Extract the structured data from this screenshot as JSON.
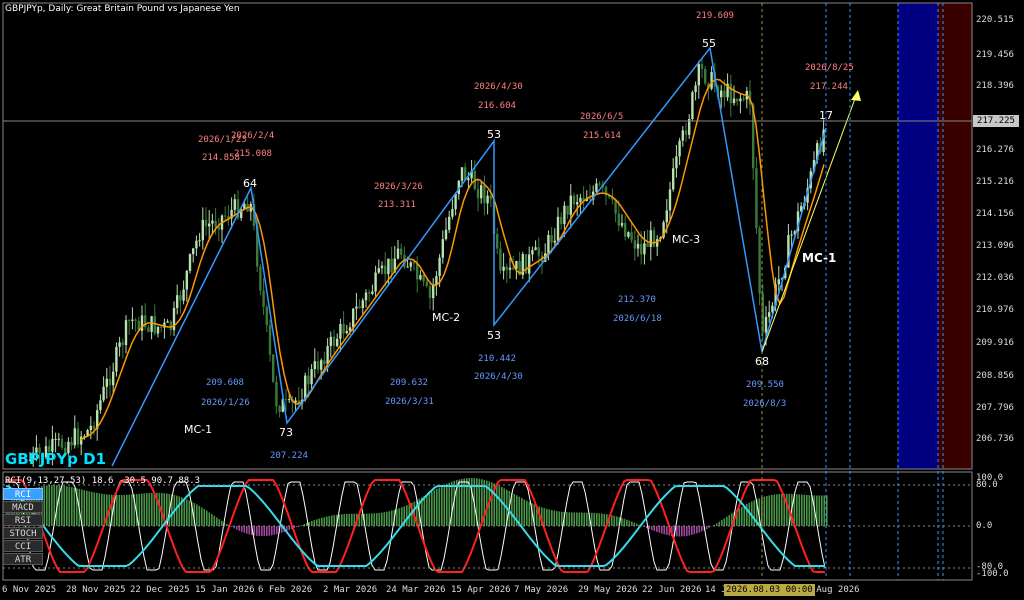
{
  "header": {
    "title": "GBPJPYp, Daily:  Great Britain Pound vs Japanese Yen",
    "big_label": "GBPJPYp D1"
  },
  "price_axis": {
    "ticks": [
      "220.515",
      "219.456",
      "218.396",
      "217.336",
      "216.276",
      "215.216",
      "214.156",
      "213.096",
      "212.036",
      "210.976",
      "209.916",
      "208.856",
      "207.796",
      "206.736"
    ],
    "current_price": "217.225"
  },
  "indicator": {
    "label": "RCI(9,13,27,53) 18.6 -30.5 90.7 88.3",
    "ticks": [
      "100.0",
      "80.0",
      "0.0",
      "-80.0",
      "-100.0"
    ],
    "buttons": [
      "RCI",
      "MACD",
      "RSI",
      "STOCH",
      "CCI",
      "ATR"
    ],
    "active_button": "RCI"
  },
  "time_axis": {
    "ticks": [
      "6 Nov 2025",
      "28 Nov 2025",
      "22 Dec 2025",
      "15 Jan 2026",
      "6 Feb 2026",
      "2 Mar 2026",
      "24 Mar 2026",
      "15 Apr 2026",
      "7 May 2026",
      "29 May 2026",
      "22 Jun 2026",
      "14 J",
      "26 Aug 2026"
    ],
    "crosshair_label": "2026.08.03 00:00"
  },
  "wave_labels": [
    "64",
    "73",
    "53",
    "53",
    "55",
    "68",
    "17"
  ],
  "cycle_labels": [
    "MC-1",
    "MC-2",
    "MC-3",
    "MC-1"
  ],
  "annotations": {
    "peaks": [
      {
        "date": "2026/1/23",
        "price": "214.858"
      },
      {
        "date": "2026/2/4",
        "price": "215.008"
      },
      {
        "date": "2026/3/26",
        "price": "213.311"
      },
      {
        "date": "2026/4/30",
        "price": "216.604"
      },
      {
        "date": "2026/6/5",
        "price": "215.614"
      },
      {
        "date": "",
        "price": "219.609"
      },
      {
        "date": "2026/8/25",
        "price": "217.244"
      }
    ],
    "troughs": [
      {
        "date": "2026/1/26",
        "price": "209.608"
      },
      {
        "date": "",
        "price": "207.224"
      },
      {
        "date": "2026/3/31",
        "price": "209.632"
      },
      {
        "date": "2026/4/30",
        "price": "210.442"
      },
      {
        "date": "2026/6/18",
        "price": "212.370"
      },
      {
        "date": "2026/8/3",
        "price": "209.550"
      }
    ]
  },
  "colors": {
    "background": "#000000",
    "bull_candle": "#b8e0b0",
    "bear_candle": "#3c7a3c",
    "moving_average": "#ff9900",
    "wave_line": "#3399ff",
    "forecast_line": "#ffff66",
    "forecast_zone": "#000080",
    "future_zone": "#3a0000",
    "peak_text": "#ff8080",
    "trough_text": "#6699ff",
    "big_label": "#00e0ff",
    "rci_short": "#ffffff",
    "rci_mid": "#ff2020",
    "rci_long": "#33ddee"
  }
}
